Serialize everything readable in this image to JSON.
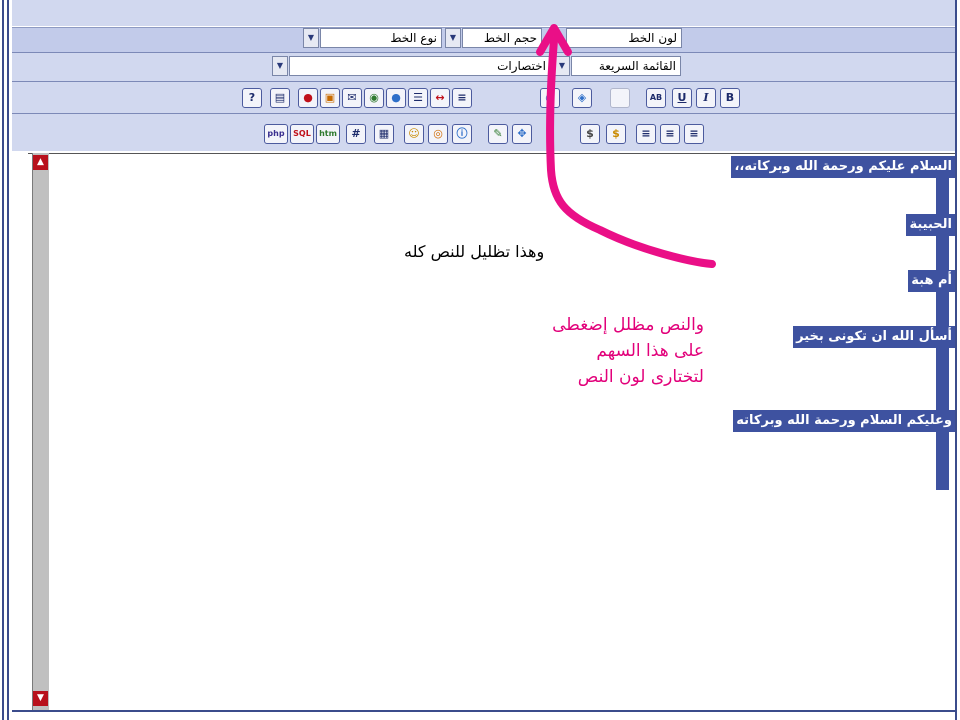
{
  "toolbar": {
    "font_color_label": "لون الخط",
    "font_size_label": "حجم الخط",
    "font_type_label": "نوع الخط",
    "quick_menu_label": "القائمة السريعة",
    "shortcuts_label": "اختصارات",
    "format_buttons": {
      "bold": "B",
      "italic": "I",
      "underline": "U",
      "strike": "AB"
    },
    "code_buttons": {
      "php": "php",
      "sql": "SQL",
      "html": "htm",
      "hash": "#"
    },
    "help_glyph": "?"
  },
  "editor": {
    "lines": [
      "السلام عليكم ورحمة الله وبركاته،،",
      "الحبيبة",
      "أم هبة",
      "أسأل الله ان تكونى بخير",
      "وعليكم السلام ورحمة الله وبركاته"
    ]
  },
  "annotations": {
    "caption": "وهذا تظليل للنص كله",
    "pink_note": "والنص مظلل إضغطى على هذا السهم لتختارى لون النص"
  },
  "colors": {
    "selection": "#3e52a0",
    "annotation": "#e2007a",
    "toolbar_bg": "#d1d8ef",
    "scroll_button": "#b8111c"
  },
  "icons": [
    "dropdown-arrow-icon",
    "help-icon",
    "document-icon",
    "flash-icon",
    "image-icon",
    "email-icon",
    "globe-icon",
    "orb-icon",
    "list-icon",
    "link-icon",
    "align-icon",
    "copyright-icon",
    "anchor-icon",
    "swatch-icon",
    "smiley-icon",
    "circle-icon",
    "info-icon",
    "pencil-icon",
    "move-icon",
    "color-icon",
    "dollar-icon",
    "align-left-icon",
    "align-center-icon",
    "align-right-icon",
    "pink-arrow-icon",
    "scroll-up-icon",
    "scroll-down-icon"
  ]
}
